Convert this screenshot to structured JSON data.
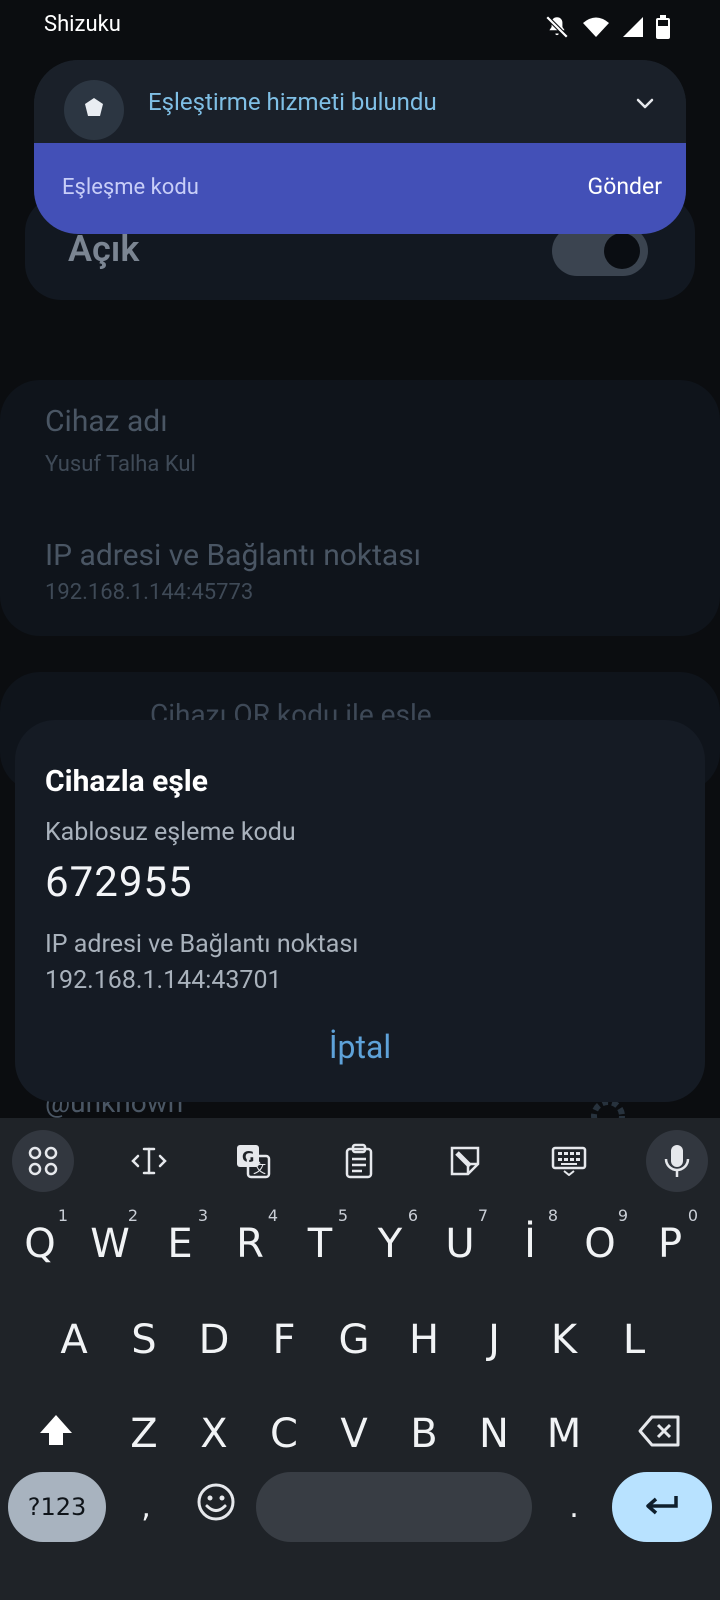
{
  "status_bar": {
    "app_name": "Shizuku",
    "icons": [
      "do-not-disturb-icon",
      "wifi-icon",
      "signal-icon",
      "battery-icon"
    ]
  },
  "background_app": {
    "on_label": "Açık",
    "device_name_label": "Cihaz adı",
    "device_name_value": "Yusuf Talha Kul",
    "ip_label": "IP adresi ve Bağlantı noktası",
    "ip_value": "192.168.1.144:45773",
    "qr_text": "Cihazı QR kodu ile eşle",
    "unknown_text": "@unknown"
  },
  "notification": {
    "title": "Eşleştirme hizmeti bulundu",
    "reply_placeholder": "Eşleşme kodu",
    "send_label": "Gönder"
  },
  "dialog": {
    "title": "Cihazla eşle",
    "code_label": "Kablosuz eşleme kodu",
    "code_value": "672955",
    "ip_label": "IP adresi ve Bağlantı noktası",
    "ip_value": "192.168.1.144:43701",
    "cancel_label": "İptal"
  },
  "keyboard": {
    "toolbar": [
      "apps-grid-icon",
      "text-cursor-icon",
      "translate-icon",
      "clipboard-icon",
      "sticker-icon",
      "keyboard-icon",
      "mic-icon"
    ],
    "row1": [
      {
        "key": "Q",
        "hint": "1"
      },
      {
        "key": "W",
        "hint": "2"
      },
      {
        "key": "E",
        "hint": "3"
      },
      {
        "key": "R",
        "hint": "4"
      },
      {
        "key": "T",
        "hint": "5"
      },
      {
        "key": "Y",
        "hint": "6"
      },
      {
        "key": "U",
        "hint": "7"
      },
      {
        "key": "İ",
        "hint": "8"
      },
      {
        "key": "O",
        "hint": "9"
      },
      {
        "key": "P",
        "hint": "0"
      }
    ],
    "row2": [
      "A",
      "S",
      "D",
      "F",
      "G",
      "H",
      "J",
      "K",
      "L"
    ],
    "row3": [
      "Z",
      "X",
      "C",
      "V",
      "B",
      "N",
      "M"
    ],
    "symbols_label": "?123",
    "comma_label": ",",
    "period_label": "."
  },
  "colors": {
    "accent_notification": "#4350b7",
    "dialog_cancel": "#5ea2d9",
    "enter_key": "#b8e2ff"
  }
}
